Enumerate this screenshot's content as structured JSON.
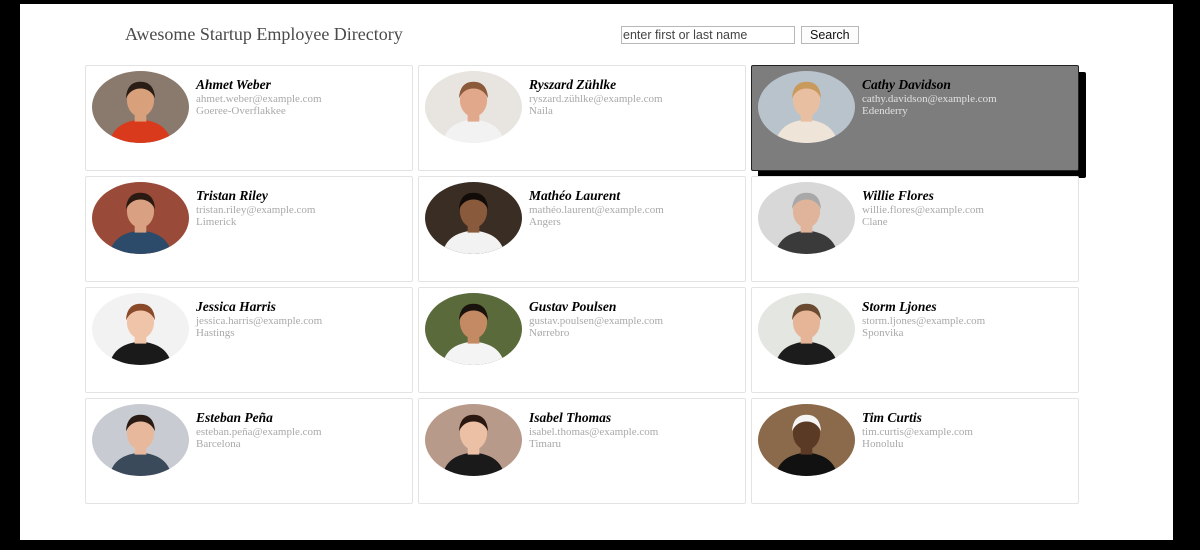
{
  "header": {
    "title": "Awesome Startup Employee Directory"
  },
  "search": {
    "placeholder": "enter first or last name",
    "value": "",
    "button_label": "Search"
  },
  "employees": [
    {
      "name": "Ahmet Weber",
      "email": "ahmet.weber@example.com",
      "city": "Goeree-Overflakkee",
      "selected": false,
      "bg": "#8a7a6e",
      "skin": "#d9a07c",
      "hair": "#2a1d16",
      "shirt": "#d93a1c"
    },
    {
      "name": "Ryszard Zühlke",
      "email": "ryszard.zühlke@example.com",
      "city": "Naila",
      "selected": false,
      "bg": "#e8e4e0",
      "skin": "#e2a88c",
      "hair": "#8a5a3a",
      "shirt": "#f2f2f2"
    },
    {
      "name": "Cathy Davidson",
      "email": "cathy.davidson@example.com",
      "city": "Edenderry",
      "selected": true,
      "bg": "#b9c3cc",
      "skin": "#e8bfa1",
      "hair": "#c89a5c",
      "shirt": "#efe4d8"
    },
    {
      "name": "Tristan Riley",
      "email": "tristan.riley@example.com",
      "city": "Limerick",
      "selected": false,
      "bg": "#9a4a38",
      "skin": "#d9a081",
      "hair": "#2a1a12",
      "shirt": "#2c4a6a"
    },
    {
      "name": "Mathéo Laurent",
      "email": "mathéo.laurent@example.com",
      "city": "Angers",
      "selected": false,
      "bg": "#3a2e24",
      "skin": "#8a5a3c",
      "hair": "#120c08",
      "shirt": "#f2f2f2"
    },
    {
      "name": "Willie Flores",
      "email": "willie.flores@example.com",
      "city": "Clane",
      "selected": false,
      "bg": "#d8d8d8",
      "skin": "#e0b49a",
      "hair": "#a8a8a8",
      "shirt": "#3a3a3a"
    },
    {
      "name": "Jessica Harris",
      "email": "jessica.harris@example.com",
      "city": "Hastings",
      "selected": false,
      "bg": "#f2f2f2",
      "skin": "#f0c4a8",
      "hair": "#8a4a2a",
      "shirt": "#1a1a1a"
    },
    {
      "name": "Gustav Poulsen",
      "email": "gustav.poulsen@example.com",
      "city": "Nørrebro",
      "selected": false,
      "bg": "#5a6a3a",
      "skin": "#c48a64",
      "hair": "#1a120c",
      "shirt": "#f4f4f4"
    },
    {
      "name": "Storm Ljones",
      "email": "storm.ljones@example.com",
      "city": "Sponvika",
      "selected": false,
      "bg": "#e4e6e2",
      "skin": "#e6b496",
      "hair": "#6a4a30",
      "shirt": "#1c1c1c"
    },
    {
      "name": "Esteban Peña",
      "email": "esteban.peña@example.com",
      "city": "Barcelona",
      "selected": false,
      "bg": "#c8ccd2",
      "skin": "#e8b89c",
      "hair": "#2a1c14",
      "shirt": "#3a4a5a"
    },
    {
      "name": "Isabel Thomas",
      "email": "isabel.thomas@example.com",
      "city": "Timaru",
      "selected": false,
      "bg": "#b89a8a",
      "skin": "#ecc0a4",
      "hair": "#2a1810",
      "shirt": "#1a1a1a"
    },
    {
      "name": "Tim Curtis",
      "email": "tim.curtis@example.com",
      "city": "Honolulu",
      "selected": false,
      "bg": "#8a6a4a",
      "skin": "#5a3a24",
      "hair": "#f4f4f4",
      "shirt": "#111111"
    }
  ]
}
